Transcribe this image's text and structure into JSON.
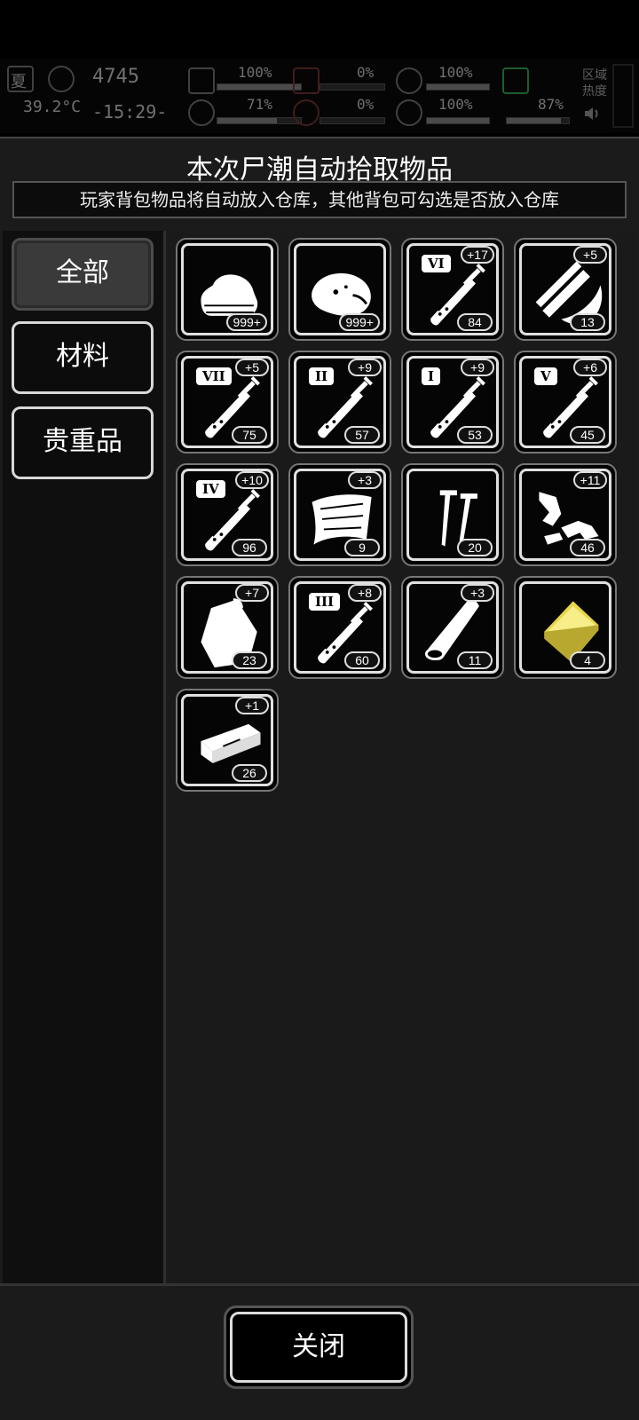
{
  "hud": {
    "season": "夏",
    "temperature": "39.2°C",
    "day_counter": "4745",
    "clock": "-15:29-",
    "health": "100%",
    "blood_loss": "0%",
    "stomach": "100%",
    "brain": "71%",
    "bleed": "0%",
    "heart": "100%",
    "stamina": "87%",
    "zone_heat": "区域热度",
    "health_level": 1.0,
    "brain_level": 0.71,
    "heart_level": 1.0,
    "stamina_level": 0.87
  },
  "dialog": {
    "title": "本次尸潮自动拾取物品",
    "subtitle": "玩家背包物品将自动放入仓库，其他背包可勾选是否放入仓库"
  },
  "tabs": [
    {
      "label": "全部",
      "active": true
    },
    {
      "label": "材料",
      "active": false
    },
    {
      "label": "贵重品",
      "active": false
    }
  ],
  "items": [
    {
      "icon": "cloth-icon",
      "count": "999+",
      "bonus": "",
      "rank": ""
    },
    {
      "icon": "meat-icon",
      "count": "999+",
      "bonus": "",
      "rank": ""
    },
    {
      "icon": "syringe-icon",
      "count": "84",
      "bonus": "+17",
      "rank": "VI"
    },
    {
      "icon": "wood-planks-icon",
      "count": "13",
      "bonus": "+5",
      "rank": ""
    },
    {
      "icon": "syringe-icon",
      "count": "75",
      "bonus": "+5",
      "rank": "VII"
    },
    {
      "icon": "syringe-icon",
      "count": "57",
      "bonus": "+9",
      "rank": "II"
    },
    {
      "icon": "syringe-icon",
      "count": "53",
      "bonus": "+9",
      "rank": "I"
    },
    {
      "icon": "syringe-icon",
      "count": "45",
      "bonus": "+6",
      "rank": "V"
    },
    {
      "icon": "syringe-icon",
      "count": "96",
      "bonus": "+10",
      "rank": "IV"
    },
    {
      "icon": "cloth-sheet-icon",
      "count": "9",
      "bonus": "+3",
      "rank": ""
    },
    {
      "icon": "nails-icon",
      "count": "20",
      "bonus": "",
      "rank": ""
    },
    {
      "icon": "scrap-parts-icon",
      "count": "46",
      "bonus": "+11",
      "rank": ""
    },
    {
      "icon": "bag-icon",
      "count": "23",
      "bonus": "+7",
      "rank": ""
    },
    {
      "icon": "syringe-icon",
      "count": "60",
      "bonus": "+8",
      "rank": "III"
    },
    {
      "icon": "log-icon",
      "count": "11",
      "bonus": "+3",
      "rank": ""
    },
    {
      "icon": "gold-plate-icon",
      "count": "4",
      "bonus": "",
      "rank": ""
    },
    {
      "icon": "brick-icon",
      "count": "26",
      "bonus": "+1",
      "rank": ""
    }
  ],
  "footer": {
    "close_label": "关闭"
  },
  "colors": {
    "gold": "#e8d64a",
    "panel": "#1b1b1b",
    "border": "#d8d8d8"
  }
}
